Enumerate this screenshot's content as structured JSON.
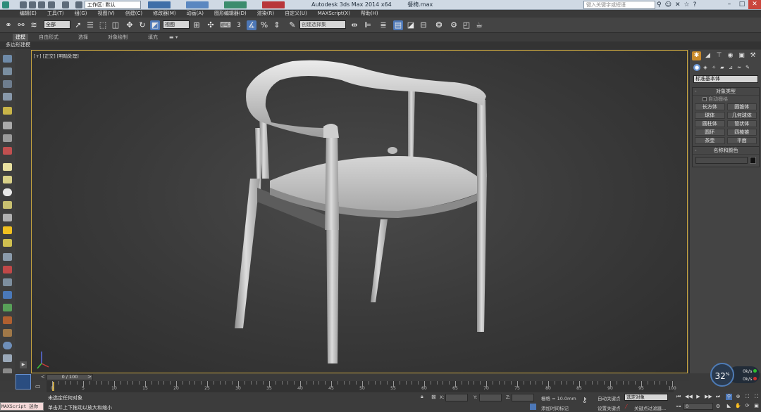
{
  "titlebar": {
    "workspace": "工作区: 默认",
    "app_name": "Autodesk 3ds Max  2014 x64",
    "file_name": "餐椅.max",
    "search_placeholder": "键入关键字或短语",
    "help_icon": "?"
  },
  "menu": [
    "编辑(E)",
    "工具(T)",
    "组(G)",
    "视图(V)",
    "创建(C)",
    "修改器(M)",
    "动画(A)",
    "图形编辑器(D)",
    "渲染(R)",
    "自定义(U)",
    "MAXScript(X)",
    "帮助(H)"
  ],
  "toolbar": {
    "selection_filter": "全部",
    "ref_coord": "视图",
    "named_sets": "创建选择集",
    "snap_label": "3",
    "angle_snap_label": "%"
  },
  "ribbon": {
    "tabs": [
      "建模",
      "自由形式",
      "选择",
      "对象绘制",
      "填充"
    ],
    "active_tab": "建模",
    "subtitle": "多边形建模"
  },
  "viewport": {
    "label": "[+] [正交] [明暗处理]",
    "accent": "#c9a640"
  },
  "command_panel": {
    "category": "标准基本体",
    "object_type_title": "对象类型",
    "autogrid": "自动栅格",
    "objects": [
      "长方体",
      "圆锥体",
      "球体",
      "几何球体",
      "圆柱体",
      "管状体",
      "圆环",
      "四棱锥",
      "茶壶",
      "平面"
    ],
    "name_color_title": "名称和颜色"
  },
  "timeline": {
    "frame_display": "0 / 100",
    "ticks": [
      0,
      5,
      10,
      15,
      20,
      25,
      30,
      35,
      40,
      45,
      50,
      55,
      60,
      65,
      70,
      75,
      80,
      85,
      90,
      95,
      100
    ],
    "current_frame": 0
  },
  "status": {
    "maxscript": "MAXScript 迷你",
    "line1": "未选定任何对象",
    "line2": "单击并上下拖动以放大和缩小",
    "x_label": "X:",
    "y_label": "Y:",
    "z_label": "Z:",
    "grid": "栅格 = 10.0mm",
    "add_time_tag": "添加时间标记",
    "auto_key": "自动关键点",
    "set_key": "设置关键点",
    "selected_dd": "选定对象",
    "key_filters": "关键点过滤器...",
    "frame_field": "0"
  },
  "fps": {
    "value": "32",
    "unit": "%",
    "row1": "0k/s",
    "row2": "0k/s"
  }
}
